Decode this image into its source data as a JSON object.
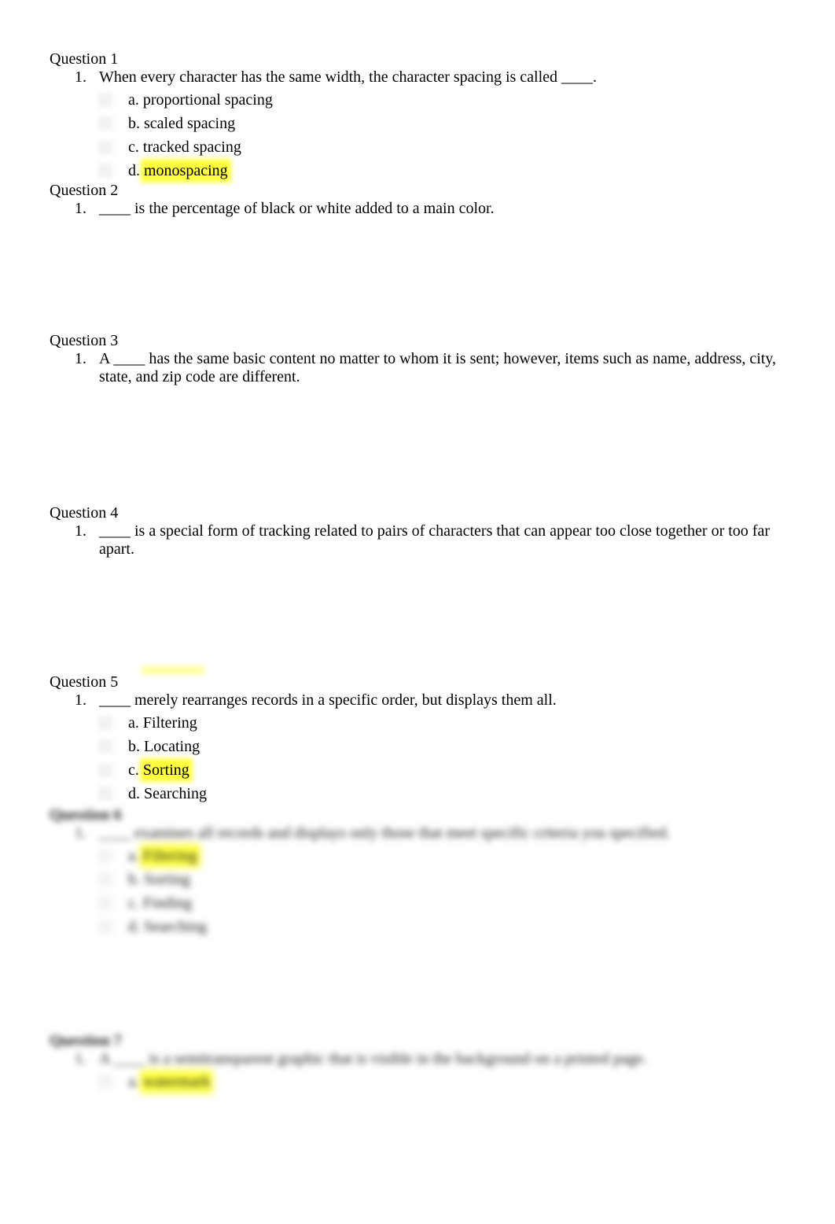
{
  "colors": {
    "highlight": "#ffff40"
  },
  "questions": [
    {
      "label": "Question 1",
      "number": "1.",
      "stem": "When every character has the same width, the character spacing is called ____.",
      "options": [
        {
          "letter": "a.",
          "text": "proportional spacing",
          "selected": false
        },
        {
          "letter": "b.",
          "text": "scaled spacing",
          "selected": false
        },
        {
          "letter": "c.",
          "text": "tracked spacing",
          "selected": false
        },
        {
          "letter": "d.",
          "text": "monospacing",
          "selected": true
        }
      ]
    },
    {
      "label": "Question 2",
      "number": "1.",
      "stem": "____ is the percentage of black or white added to a main color.",
      "options": []
    },
    {
      "label": "Question 3",
      "number": "1.",
      "stem": "A ____ has the same basic content no matter to whom it is sent; however, items such as name, address, city, state, and zip code are different.",
      "options": []
    },
    {
      "label": "Question 4",
      "number": "1.",
      "stem": "____ is a special form of tracking related to pairs of characters that can appear too close together or too far apart.",
      "options": []
    },
    {
      "label": "Question 5",
      "number": "1.",
      "stem": "____ merely rearranges records in a specific order, but displays them all.",
      "options": [
        {
          "letter": "a.",
          "text": "Filtering",
          "selected": false
        },
        {
          "letter": "b.",
          "text": "Locating",
          "selected": false
        },
        {
          "letter": "c.",
          "text": "Sorting",
          "selected": true
        },
        {
          "letter": "d.",
          "text": "Searching",
          "selected": false
        }
      ]
    },
    {
      "label": "Question 6",
      "number": "1.",
      "stem": "____ examines all records and displays only those that meet specific criteria you specified.",
      "options": [
        {
          "letter": "a.",
          "text": "Filtering",
          "selected": true
        },
        {
          "letter": "b.",
          "text": "Sorting",
          "selected": false
        },
        {
          "letter": "c.",
          "text": "Finding",
          "selected": false
        },
        {
          "letter": "d.",
          "text": "Searching",
          "selected": false
        }
      ]
    },
    {
      "label": "Question 7",
      "number": "1.",
      "stem": "A ____ is a semitransparent graphic that is visible in the background on a printed page.",
      "options": [
        {
          "letter": "a.",
          "text": "watermark",
          "selected": true
        }
      ]
    }
  ]
}
